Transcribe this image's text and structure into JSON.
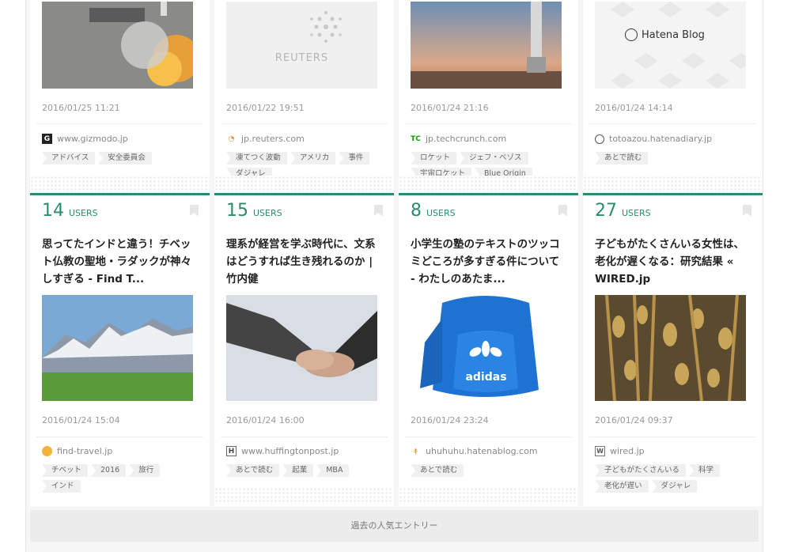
{
  "colors": {
    "accent": "#2a8c6e",
    "tag_bg": "#f0f0f0"
  },
  "top_cards": [
    {
      "date": "2016/01/25 11:21",
      "site": "www.gizmodo.jp",
      "favicon": "G",
      "tags": [
        "アドバイス",
        "安全委員会"
      ]
    },
    {
      "date": "2016/01/22 19:51",
      "site": "jp.reuters.com",
      "favicon": "rss-icon",
      "thumb_text": "REUTERS",
      "tags": [
        "凍てつく波動",
        "アメリカ",
        "事件",
        "ダジャレ"
      ]
    },
    {
      "date": "2016/01/24 21:16",
      "site": "jp.techcrunch.com",
      "favicon": "TC",
      "tags": [
        "ロケット",
        "ジェフ・ベゾス",
        "宇宙ロケット",
        "Blue Origin"
      ]
    },
    {
      "date": "2016/01/24 14:14",
      "site": "totoazou.hatenadiary.jp",
      "favicon": "hatena-icon",
      "thumb_text": "Hatena Blog",
      "tags": [
        "あとで読む"
      ]
    }
  ],
  "entries": [
    {
      "count": "14",
      "users_label": "USERS",
      "title": "思ってたインドと違う！チベット仏教の聖地・ラダックが神々しすぎる - Find T...",
      "date": "2016/01/24 15:04",
      "site": "find-travel.jp",
      "tags": [
        "チベット",
        "2016",
        "旅行",
        "インド"
      ]
    },
    {
      "count": "15",
      "users_label": "USERS",
      "title": "理系が経営を学ぶ時代に、文系はどうすれば生き残れるのか | 竹内健",
      "date": "2016/01/24 16:00",
      "site": "www.huffingtonpost.jp",
      "tags": [
        "あとで読む",
        "起業",
        "MBA"
      ]
    },
    {
      "count": "8",
      "users_label": "USERS",
      "title": "小学生の塾のテキストのツッコミどころが多すぎる件について - わたしのあたま...",
      "date": "2016/01/24 23:24",
      "site": "uhuhuhu.hatenablog.com",
      "tags": [
        "あとで読む"
      ],
      "img_text": "adidas"
    },
    {
      "count": "27",
      "users_label": "USERS",
      "title": "子どもがたくさんいる女性は、老化が遅くなる：研究結果 « WIRED.jp",
      "date": "2016/01/24 09:37",
      "site": "wired.jp",
      "tags": [
        "子どもがたくさんいる",
        "科学",
        "老化が遅い",
        "ダジャレ"
      ]
    }
  ],
  "more_label": "過去の人気エントリー"
}
